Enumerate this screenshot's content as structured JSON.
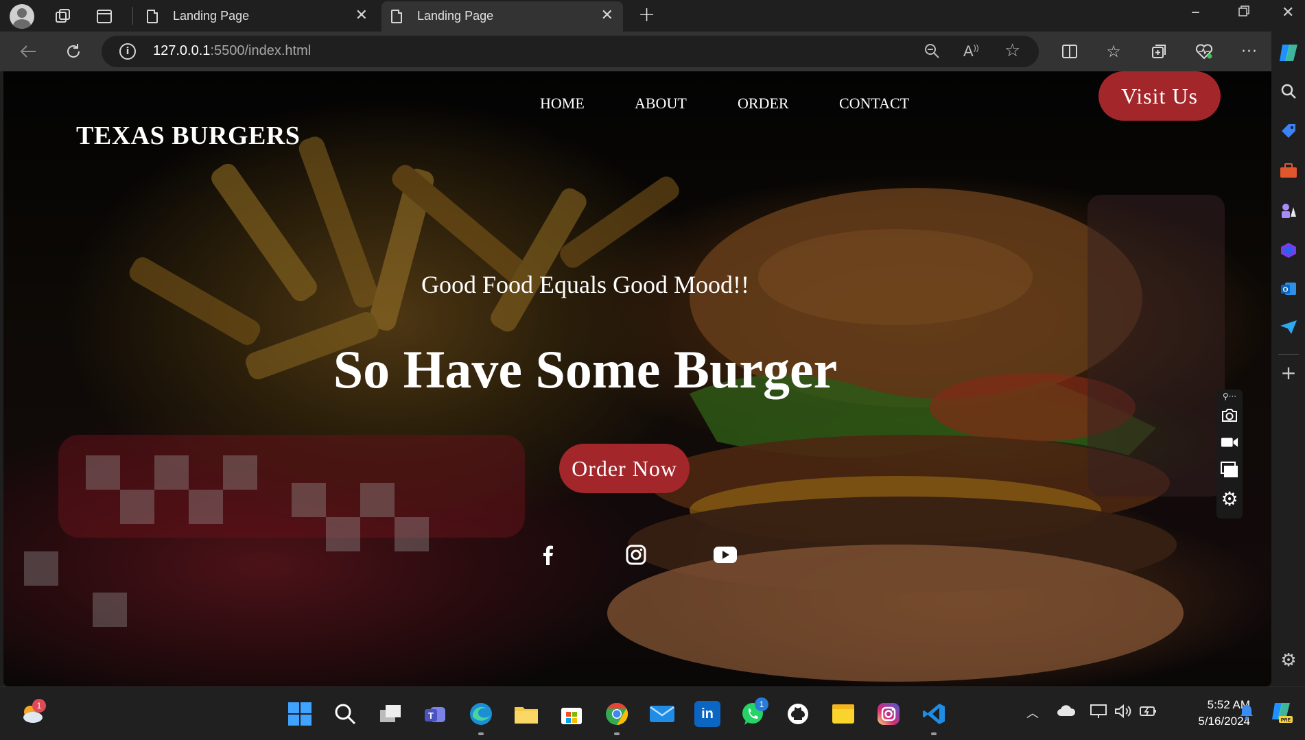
{
  "browser": {
    "tabs": [
      {
        "label": "Landing Page",
        "active": false
      },
      {
        "label": "Landing Page",
        "active": true
      }
    ],
    "url_host": "127.0.0.1",
    "url_rest": ":5500/index.html"
  },
  "page": {
    "logo": "TEXAS BURGERS",
    "nav": [
      "HOME",
      "ABOUT",
      "ORDER",
      "CONTACT"
    ],
    "visit_button": "Visit Us",
    "tagline": "Good Food Equals Good Mood!!",
    "headline": "So Have Some Burger",
    "order_button": "Order Now",
    "social": [
      "facebook-icon",
      "instagram-icon",
      "youtube-icon"
    ]
  },
  "taskbar": {
    "weather_badge": "1",
    "whatsapp_badge": "1",
    "time": "5:52 AM",
    "date": "5/16/2024"
  },
  "colors": {
    "accent_red": "#a3262b",
    "browser_dark": "#1f1f1f",
    "browser_mid": "#333333"
  }
}
